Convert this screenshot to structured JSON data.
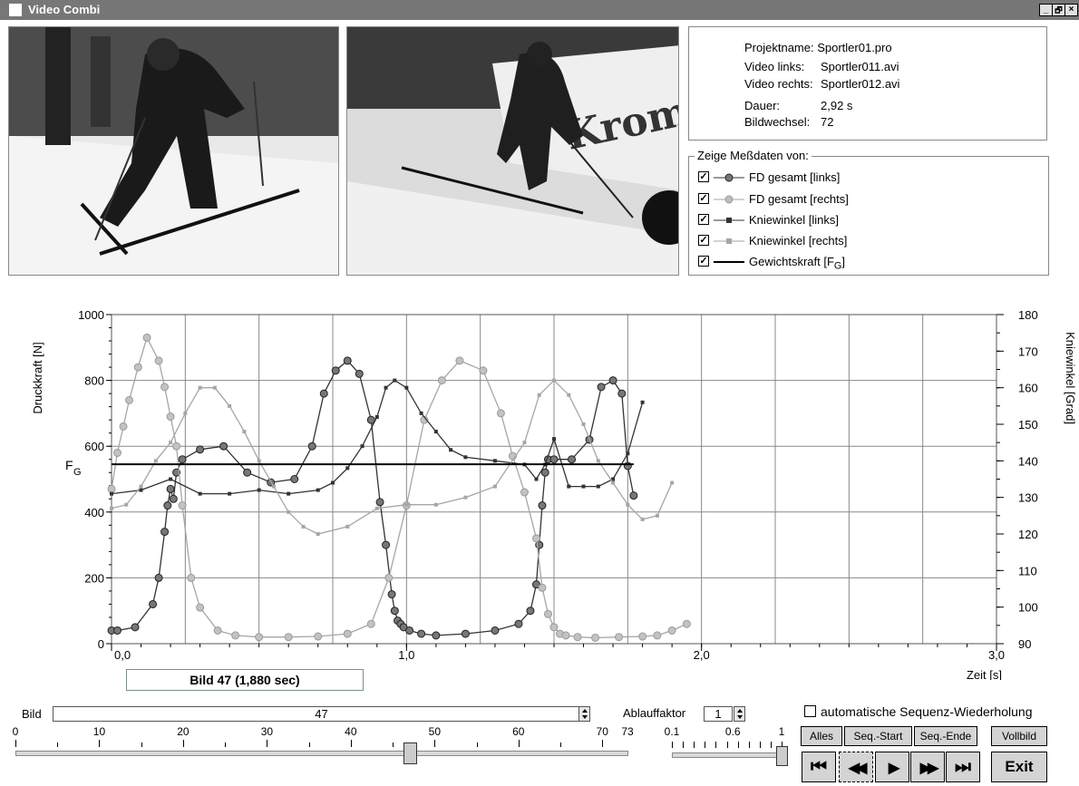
{
  "window": {
    "title": "Video Combi",
    "min_glyph": "_",
    "max_glyph": "🗗",
    "close_glyph": "×"
  },
  "info": {
    "rows": [
      {
        "label": "Projektname:",
        "value": "Sportler01.pro"
      },
      {
        "label": "Video links:",
        "value": "Sportler011.avi"
      },
      {
        "label": "Video rechts:",
        "value": "Sportler012.avi"
      },
      {
        "label": "Dauer:",
        "value": "2,92 s"
      },
      {
        "label": "Bildwechsel:",
        "value": "72"
      }
    ]
  },
  "legend": {
    "title": "Zeige Meßdaten von:",
    "items": [
      {
        "label": "FD gesamt [links]",
        "checked": true,
        "color": "#333333",
        "marker": "circle"
      },
      {
        "label": "FD gesamt [rechts]",
        "checked": true,
        "color": "#a6a6a6",
        "marker": "circle"
      },
      {
        "label": "Kniewinkel [links]",
        "checked": true,
        "color": "#333333",
        "marker": "square"
      },
      {
        "label": "Kniewinkel [rechts]",
        "checked": true,
        "color": "#a6a6a6",
        "marker": "square"
      },
      {
        "label": "Gewichtskraft [F",
        "label_sub": "G",
        "label_end": "]",
        "checked": true,
        "color": "#000000",
        "marker": "line"
      }
    ]
  },
  "chart_data": {
    "type": "line",
    "ylabel": "Druckkraft [N]",
    "y2label": "Kniewinkel [Grad]",
    "xlabel": "Zeit [s]",
    "xlim": [
      0,
      3.0
    ],
    "ylim": [
      0,
      1000
    ],
    "y2lim": [
      90,
      180
    ],
    "xticks": [
      "0,0",
      "1,0",
      "2,0",
      "3,0"
    ],
    "yticks": [
      "0",
      "200",
      "400",
      "600",
      "800",
      "1000"
    ],
    "y2ticks": [
      "90",
      "100",
      "110",
      "120",
      "130",
      "140",
      "150",
      "160",
      "170",
      "180"
    ],
    "fg_label": "F",
    "fg_sub": "G",
    "fg_value": 545,
    "series": [
      {
        "name": "FD gesamt [links]",
        "axis": "left",
        "marker": "circle",
        "color": "#333333",
        "x": [
          0,
          0.02,
          0.08,
          0.14,
          0.16,
          0.18,
          0.19,
          0.2,
          0.21,
          0.22,
          0.24,
          0.3,
          0.38,
          0.46,
          0.54,
          0.62,
          0.68,
          0.72,
          0.76,
          0.8,
          0.84,
          0.88,
          0.91,
          0.93,
          0.95,
          0.96,
          0.97,
          0.98,
          0.99,
          1.01,
          1.05,
          1.1,
          1.2,
          1.3,
          1.38,
          1.42,
          1.44,
          1.45,
          1.46,
          1.47,
          1.48,
          1.5,
          1.56,
          1.62,
          1.66,
          1.7,
          1.73,
          1.75,
          1.77
        ],
        "y": [
          40,
          40,
          50,
          120,
          200,
          340,
          420,
          470,
          440,
          520,
          560,
          590,
          600,
          520,
          490,
          500,
          600,
          760,
          830,
          860,
          820,
          680,
          430,
          300,
          150,
          100,
          70,
          60,
          50,
          40,
          30,
          25,
          30,
          40,
          60,
          100,
          180,
          300,
          420,
          520,
          560,
          560,
          560,
          620,
          780,
          800,
          760,
          540,
          450
        ]
      },
      {
        "name": "FD gesamt [rechts]",
        "axis": "left",
        "marker": "circle",
        "color": "#a6a6a6",
        "x": [
          0,
          0.02,
          0.04,
          0.06,
          0.09,
          0.12,
          0.16,
          0.18,
          0.2,
          0.22,
          0.24,
          0.27,
          0.3,
          0.36,
          0.42,
          0.5,
          0.6,
          0.7,
          0.8,
          0.88,
          0.94,
          1.0,
          1.06,
          1.12,
          1.18,
          1.26,
          1.32,
          1.36,
          1.4,
          1.44,
          1.46,
          1.48,
          1.5,
          1.52,
          1.54,
          1.58,
          1.64,
          1.72,
          1.8,
          1.85,
          1.9,
          1.95
        ],
        "y": [
          470,
          580,
          660,
          740,
          840,
          930,
          860,
          780,
          690,
          600,
          420,
          200,
          110,
          40,
          25,
          20,
          20,
          22,
          30,
          60,
          200,
          420,
          680,
          800,
          860,
          830,
          700,
          570,
          460,
          320,
          170,
          90,
          50,
          30,
          25,
          20,
          18,
          20,
          22,
          25,
          40,
          60
        ]
      },
      {
        "name": "Kniewinkel [links]",
        "axis": "right",
        "marker": "square",
        "color": "#333333",
        "x": [
          0,
          0.1,
          0.2,
          0.3,
          0.4,
          0.5,
          0.6,
          0.7,
          0.75,
          0.8,
          0.85,
          0.9,
          0.93,
          0.96,
          1.0,
          1.05,
          1.1,
          1.15,
          1.2,
          1.3,
          1.4,
          1.44,
          1.47,
          1.5,
          1.55,
          1.6,
          1.65,
          1.7,
          1.75,
          1.8
        ],
        "x_note": "",
        "y": [
          131,
          132,
          135,
          131,
          131,
          132,
          131,
          132,
          134,
          138,
          144,
          152,
          160,
          162,
          160,
          153,
          148,
          143,
          141,
          140,
          139,
          135,
          139,
          146,
          133,
          133,
          133,
          135,
          142,
          156
        ]
      },
      {
        "name": "Kniewinkel [rechts]",
        "axis": "right",
        "marker": "square",
        "color": "#a6a6a6",
        "x": [
          0,
          0.05,
          0.1,
          0.15,
          0.2,
          0.25,
          0.3,
          0.35,
          0.4,
          0.45,
          0.5,
          0.55,
          0.6,
          0.65,
          0.7,
          0.8,
          0.9,
          1.0,
          1.1,
          1.2,
          1.3,
          1.4,
          1.45,
          1.5,
          1.55,
          1.6,
          1.65,
          1.7,
          1.75,
          1.8,
          1.85,
          1.9
        ],
        "y": [
          127,
          128,
          133,
          140,
          145,
          153,
          160,
          160,
          155,
          148,
          140,
          133,
          126,
          122,
          120,
          122,
          127,
          128,
          128,
          130,
          133,
          145,
          158,
          162,
          158,
          150,
          140,
          134,
          128,
          124,
          125,
          134
        ]
      }
    ]
  },
  "bild_label": "Bild 47 (1,880 sec)",
  "frame": {
    "label": "Bild",
    "value": "47",
    "min": 0,
    "max": 73,
    "current": 47,
    "ticks": [
      "0",
      "10",
      "20",
      "30",
      "40",
      "50",
      "60",
      "70",
      "73"
    ]
  },
  "speed": {
    "label": "Ablauffaktor",
    "value": "1",
    "ticks": [
      "0.1",
      "0.6",
      "1"
    ],
    "level": 1.0
  },
  "repeat": {
    "label": "automatische Sequenz-Wiederholung",
    "checked": false
  },
  "buttons": {
    "alles": "Alles",
    "seq_start": "Seq.-Start",
    "seq_end": "Seq.-Ende",
    "vollbild": "Vollbild",
    "exit": "Exit"
  },
  "nav": {
    "first": "⏮",
    "rewind": "◀◀",
    "play": "▶",
    "forward": "▶▶",
    "last": "⏭"
  }
}
